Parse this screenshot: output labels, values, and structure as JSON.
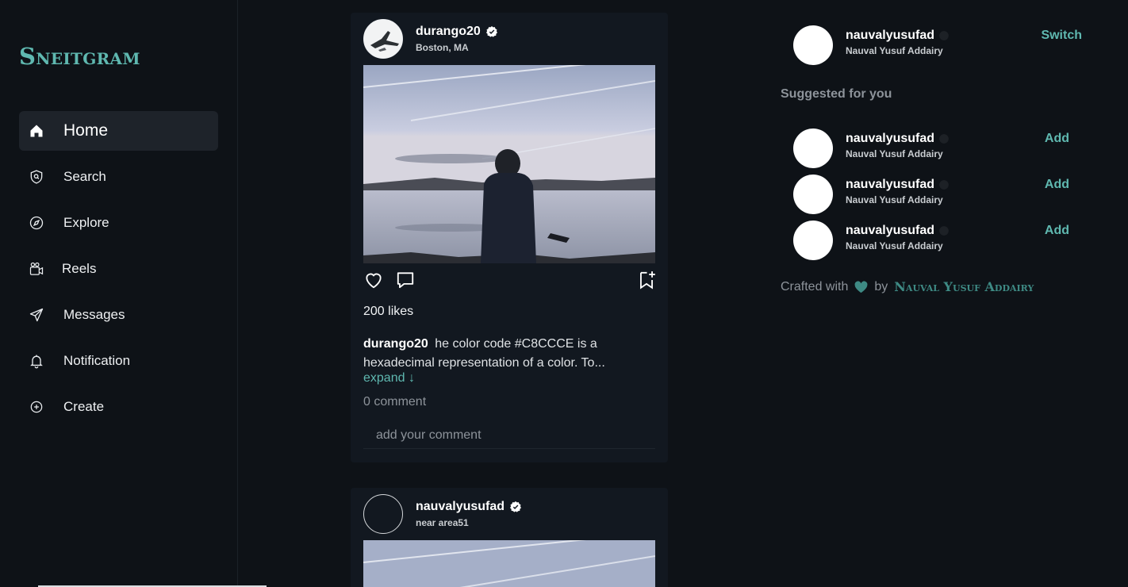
{
  "brand": "Sneitgram",
  "nav": [
    {
      "label": "Home",
      "icon": "home-icon",
      "active": true
    },
    {
      "label": "Search",
      "icon": "search-icon"
    },
    {
      "label": "Explore",
      "icon": "compass-icon"
    },
    {
      "label": "Reels",
      "icon": "reels-icon"
    },
    {
      "label": "Messages",
      "icon": "send-icon"
    },
    {
      "label": "Notification",
      "icon": "bell-icon"
    },
    {
      "label": "Create",
      "icon": "plus-circle-icon"
    }
  ],
  "posts": [
    {
      "username": "durango20",
      "location": "Boston, MA",
      "likes": "200 likes",
      "caption_user": "durango20",
      "caption_text": "he color code #C8CCCE is a hexadecimal representation of a color. To...",
      "expand": "expand ↓",
      "comments": "0 comment",
      "comment_placeholder": "add your comment"
    },
    {
      "username": "nauvalyusufad",
      "location": "near area51"
    }
  ],
  "current_user": {
    "username": "nauvalyusufad",
    "fullname": "Nauval Yusuf Addairy",
    "action": "Switch"
  },
  "suggested_title": "Suggested for you",
  "suggestions": [
    {
      "username": "nauvalyusufad",
      "fullname": "Nauval Yusuf Addairy",
      "action": "Add"
    },
    {
      "username": "nauvalyusufad",
      "fullname": "Nauval Yusuf Addairy",
      "action": "Add"
    },
    {
      "username": "nauvalyusufad",
      "fullname": "Nauval Yusuf Addairy",
      "action": "Add"
    }
  ],
  "footer": {
    "prefix": "Crafted with",
    "by": "by",
    "author": "Nauval Yusuf Addairy"
  },
  "colors": {
    "accent": "#5fb8b0",
    "background": "#0e1217",
    "card": "#121820",
    "active_nav": "#1e232a"
  }
}
